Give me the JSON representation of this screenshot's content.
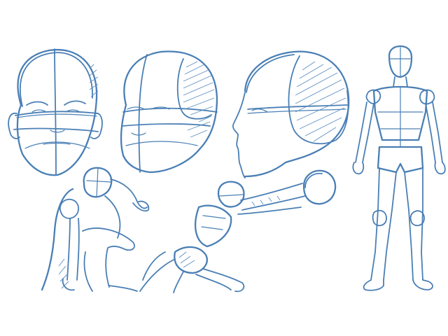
{
  "scene": {
    "background": "#ffffff",
    "line_color": "#4a7fb5",
    "figures": [
      "head-front",
      "head-three-quarter",
      "head-profile",
      "body-crouching",
      "body-reaching-with-ball",
      "body-standing-front"
    ]
  }
}
